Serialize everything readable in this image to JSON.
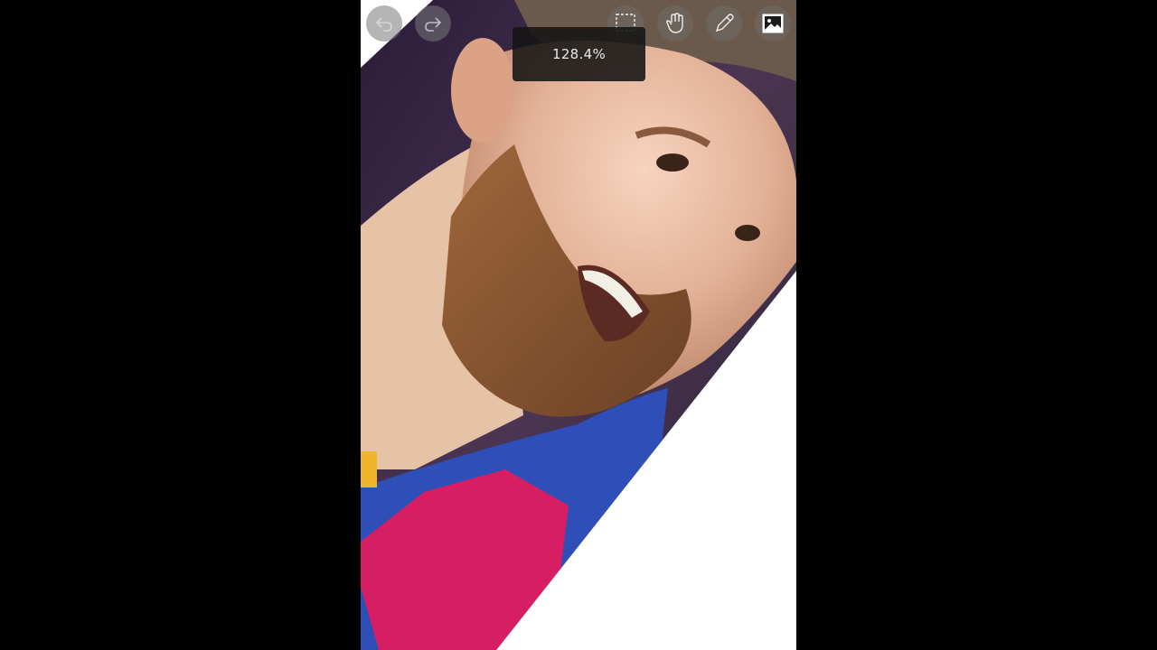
{
  "app": {
    "zoom_level": "128.4%"
  },
  "toolbar": {
    "undo_icon": "undo-icon",
    "redo_icon": "redo-icon",
    "selection_icon": "selection-rectangle-icon",
    "hand_icon": "hand-pan-icon",
    "pen_icon": "pen-icon",
    "image_icon": "image-icon"
  },
  "colors": {
    "background": "#000000",
    "canvas_white": "#ffffff",
    "zoom_pill_bg": "#141414",
    "zoom_text": "#e9e9e9"
  }
}
